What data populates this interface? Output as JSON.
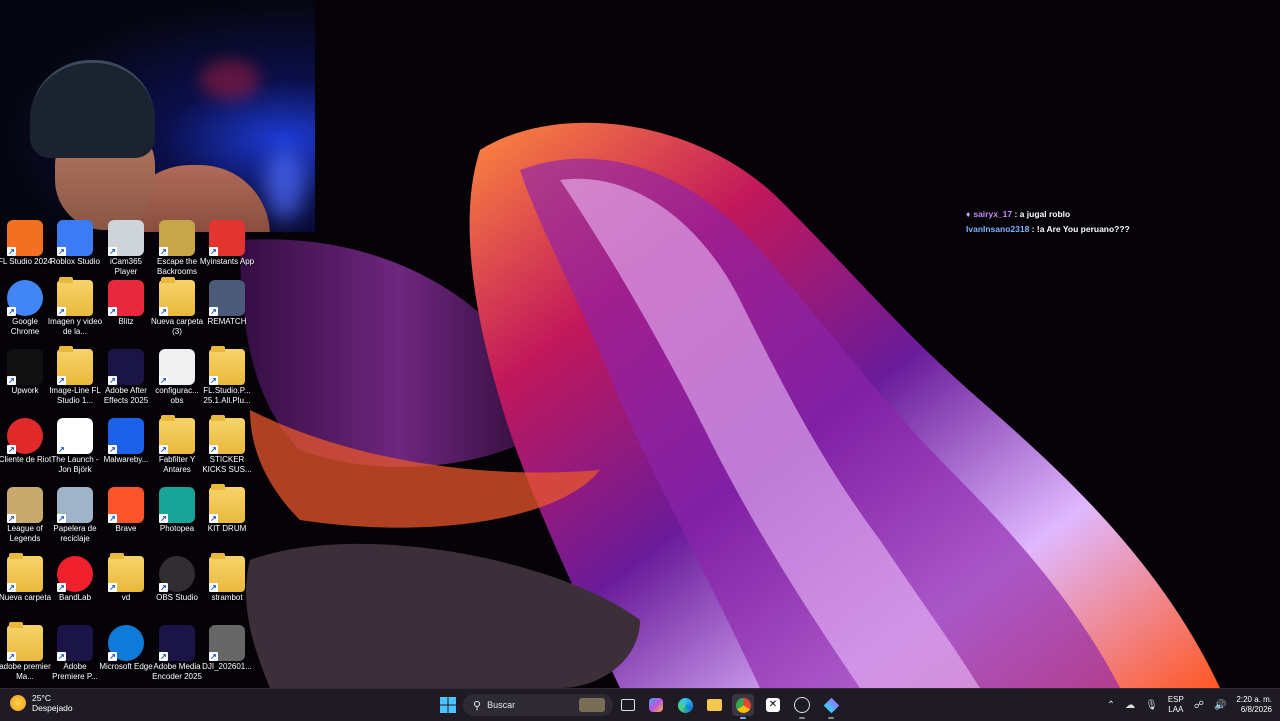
{
  "chat": {
    "messages": [
      {
        "user": "sairyx_17",
        "user_color": "#c98bff",
        "text": "a jugal roblo"
      },
      {
        "user": "IvanInsano2318",
        "user_color": "#7fb4ff",
        "text": "!a Are You peruano???"
      }
    ]
  },
  "desktop": {
    "icons": [
      {
        "label": "FL Studio 2024",
        "icon": "fl-studio-icon",
        "color": "#f36f21"
      },
      {
        "label": "Roblox Studio",
        "icon": "roblox-studio-icon",
        "color": "#3b7cf5"
      },
      {
        "label": "iCam365 Player",
        "icon": "icam365-icon",
        "color": "#cfd4da"
      },
      {
        "label": "Escape the Backrooms",
        "icon": "backrooms-icon",
        "color": "#c7a64a"
      },
      {
        "label": "Myinstants App",
        "icon": "myinstants-icon",
        "color": "#e3342f"
      },
      {
        "label": "Google Chrome",
        "icon": "chrome-icon",
        "color": "#4285f4"
      },
      {
        "label": "Imagen y video de la...",
        "icon": "folder-icon",
        "color": "#f3c84b"
      },
      {
        "label": "Blitz",
        "icon": "blitz-icon",
        "color": "#e8283c"
      },
      {
        "label": "Nueva carpeta (3)",
        "icon": "folder-icon",
        "color": "#f3c84b"
      },
      {
        "label": "REMATCH",
        "icon": "rematch-icon",
        "color": "#4a5a78"
      },
      {
        "label": "Upwork",
        "icon": "upwork-icon",
        "color": "#111111"
      },
      {
        "label": "Image-Line FL Studio 1...",
        "icon": "folder-icon",
        "color": "#f3c84b"
      },
      {
        "label": "Adobe After Effects 2025",
        "icon": "after-effects-icon",
        "color": "#1a1447"
      },
      {
        "label": "configurac... obs",
        "icon": "json-file-icon",
        "color": "#f0f0f0"
      },
      {
        "label": "FL.Studio.P... 25.1.All.Plu...",
        "icon": "folder-icon",
        "color": "#f3c84b"
      },
      {
        "label": "Cliente de Riot",
        "icon": "riot-client-icon",
        "color": "#e02a2a"
      },
      {
        "label": "The Launch - Jon Björk",
        "icon": "video-file-icon",
        "color": "#ffffff"
      },
      {
        "label": "Malwareby...",
        "icon": "malwarebytes-icon",
        "color": "#1c62e8"
      },
      {
        "label": "Fabfilter Y Antares",
        "icon": "folder-icon",
        "color": "#f3c84b"
      },
      {
        "label": "STICKER KICKS SUS...",
        "icon": "folder-icon",
        "color": "#f3c84b"
      },
      {
        "label": "League of Legends",
        "icon": "league-of-legends-icon",
        "color": "#c8aa6e"
      },
      {
        "label": "Papelera de reciclaje",
        "icon": "recycle-bin-icon",
        "color": "#9fb4c8"
      },
      {
        "label": "Brave",
        "icon": "brave-icon",
        "color": "#fb542b"
      },
      {
        "label": "Photopea",
        "icon": "photopea-icon",
        "color": "#18a497"
      },
      {
        "label": "KIT DRUM",
        "icon": "folder-icon",
        "color": "#f3c84b"
      },
      {
        "label": "Nueva carpeta",
        "icon": "folder-icon",
        "color": "#f3c84b"
      },
      {
        "label": "BandLab",
        "icon": "bandlab-icon",
        "color": "#f0202d"
      },
      {
        "label": "vd",
        "icon": "folder-icon",
        "color": "#f3c84b"
      },
      {
        "label": "OBS Studio",
        "icon": "obs-icon",
        "color": "#302e31"
      },
      {
        "label": "strambot",
        "icon": "folder-icon",
        "color": "#f3c84b"
      },
      {
        "label": "adobe premier Ma...",
        "icon": "folder-icon",
        "color": "#f3c84b"
      },
      {
        "label": "Adobe Premiere P...",
        "icon": "premiere-pro-icon",
        "color": "#1a1447"
      },
      {
        "label": "Microsoft Edge",
        "icon": "edge-icon",
        "color": "#0f7bd8"
      },
      {
        "label": "Adobe Media Encoder 2025",
        "icon": "media-encoder-icon",
        "color": "#1a1447"
      },
      {
        "label": "DJI_202601...",
        "icon": "video-thumbnail-icon",
        "color": "#666666"
      }
    ]
  },
  "taskbar": {
    "weather": {
      "temp": "25°C",
      "condition": "Despejado"
    },
    "search_placeholder": "Buscar",
    "language": {
      "lang": "ESP",
      "layout": "LAA"
    },
    "clock": {
      "time": "2:20 a. m.",
      "date": "6/8/2026"
    }
  }
}
